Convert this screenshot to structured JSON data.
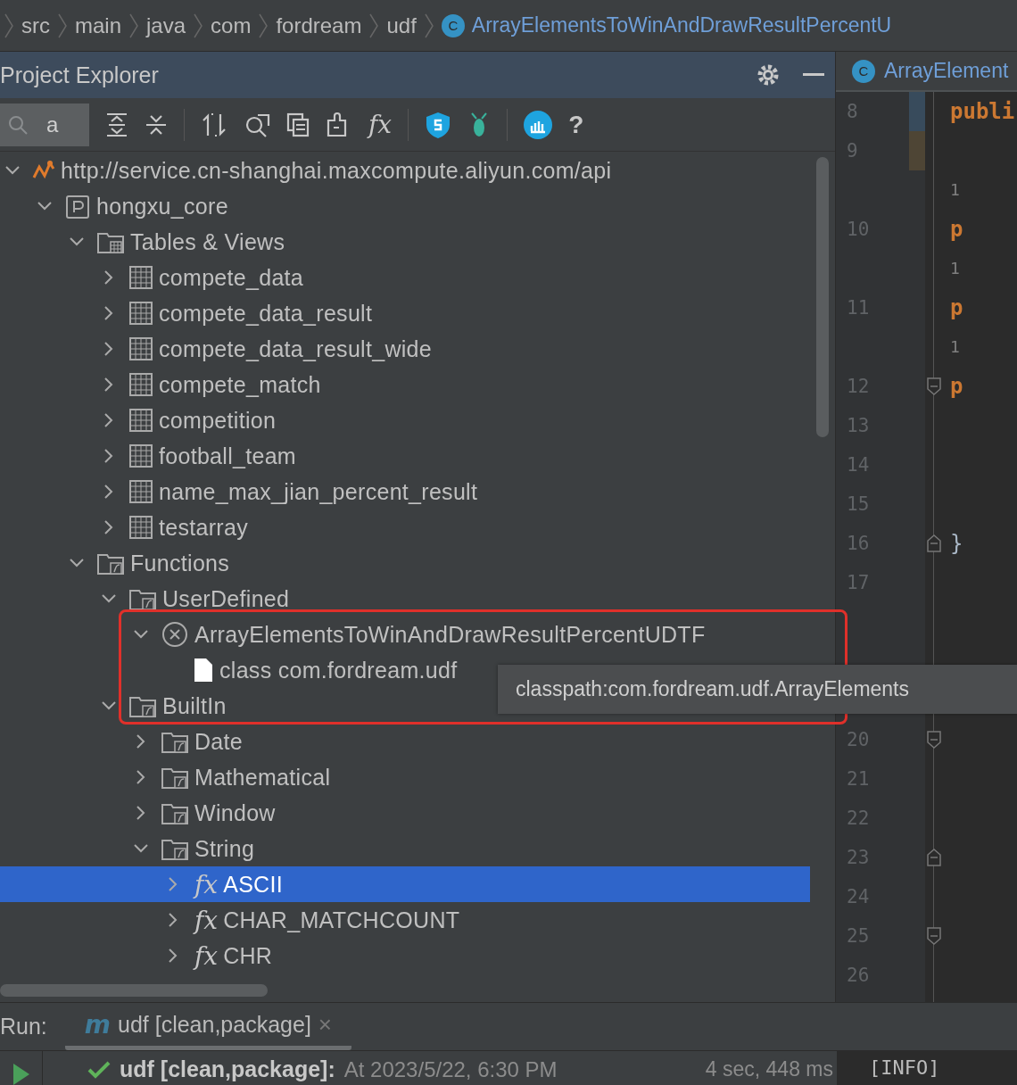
{
  "breadcrumb": {
    "items": [
      "src",
      "main",
      "java",
      "com",
      "fordream",
      "udf"
    ],
    "class_icon": "C",
    "current": "ArrayElementsToWinAndDrawResultPercentU"
  },
  "project_explorer": {
    "title": "Project Explorer",
    "search": {
      "value": "a"
    },
    "toolbar": [
      {
        "kind": "expand"
      },
      {
        "kind": "collapse"
      },
      {
        "kind": "sep"
      },
      {
        "kind": "sync"
      },
      {
        "kind": "find"
      },
      {
        "kind": "copy"
      },
      {
        "kind": "plugin"
      },
      {
        "kind": "function",
        "glyph": "fx"
      },
      {
        "kind": "sep"
      },
      {
        "kind": "shield"
      },
      {
        "kind": "bug"
      },
      {
        "kind": "sep"
      },
      {
        "kind": "chart"
      },
      {
        "kind": "help",
        "glyph": "?"
      }
    ],
    "tree": [
      {
        "label": "http://service.cn-shanghai.maxcompute.aliyun.com/api",
        "kind": "connection",
        "expanded": true,
        "selected": false,
        "children": [
          {
            "label": "hongxu_core",
            "kind": "project",
            "expanded": true,
            "selected": false,
            "children": [
              {
                "label": "Tables & Views",
                "kind": "tablefolder",
                "expanded": true,
                "selected": false,
                "children": [
                  {
                    "label": "compete_data",
                    "kind": "table",
                    "expanded": false,
                    "selected": false
                  },
                  {
                    "label": "compete_data_result",
                    "kind": "table",
                    "expanded": false,
                    "selected": false
                  },
                  {
                    "label": "compete_data_result_wide",
                    "kind": "table",
                    "expanded": false,
                    "selected": false
                  },
                  {
                    "label": "compete_match",
                    "kind": "table",
                    "expanded": false,
                    "selected": false
                  },
                  {
                    "label": "competition",
                    "kind": "table",
                    "expanded": false,
                    "selected": false
                  },
                  {
                    "label": "football_team",
                    "kind": "table",
                    "expanded": false,
                    "selected": false
                  },
                  {
                    "label": "name_max_jian_percent_result",
                    "kind": "table",
                    "expanded": false,
                    "selected": false
                  },
                  {
                    "label": "testarray",
                    "kind": "table",
                    "expanded": false,
                    "selected": false
                  }
                ]
              },
              {
                "label": "Functions",
                "kind": "fxfolder",
                "expanded": true,
                "selected": false,
                "children": [
                  {
                    "label": "UserDefined",
                    "kind": "fxfolder",
                    "expanded": true,
                    "selected": false,
                    "children": [
                      {
                        "label": "ArrayElementsToWinAndDrawResultPercentUDTF",
                        "kind": "error",
                        "expanded": true,
                        "selected": false,
                        "children": [
                          {
                            "label": "class com.fordream.udf",
                            "kind": "file",
                            "selected": false
                          }
                        ]
                      }
                    ]
                  },
                  {
                    "label": "BuiltIn",
                    "kind": "fxfolder",
                    "expanded": true,
                    "selected": false,
                    "children": [
                      {
                        "label": "Date",
                        "kind": "fxfolder",
                        "expanded": false,
                        "selected": false
                      },
                      {
                        "label": "Mathematical",
                        "kind": "fxfolder",
                        "expanded": false,
                        "selected": false
                      },
                      {
                        "label": "Window",
                        "kind": "fxfolder",
                        "expanded": false,
                        "selected": false
                      },
                      {
                        "label": "String",
                        "kind": "fxfolder",
                        "expanded": true,
                        "selected": false,
                        "children": [
                          {
                            "label": "ASCII",
                            "kind": "fx",
                            "glyph": "fx",
                            "expanded": false,
                            "selected": true
                          },
                          {
                            "label": "CHAR_MATCHCOUNT",
                            "kind": "fx",
                            "glyph": "fx",
                            "expanded": false,
                            "selected": false
                          },
                          {
                            "label": "CHR",
                            "kind": "fx",
                            "glyph": "fx",
                            "expanded": false,
                            "selected": false
                          }
                        ]
                      }
                    ]
                  }
                ]
              }
            ]
          }
        ]
      }
    ],
    "tooltip": "classpath:com.fordream.udf.ArrayElements"
  },
  "editor": {
    "tab": {
      "class_icon": "C",
      "title": "ArrayElement"
    },
    "rows": [
      {
        "kind": "line",
        "number": "8",
        "code": "publi",
        "color": "#384b5c"
      },
      {
        "kind": "line",
        "number": "9",
        "color": "#4e4535"
      },
      {
        "kind": "hint",
        "code": "1"
      },
      {
        "kind": "line",
        "number": "10",
        "code": "p"
      },
      {
        "kind": "hint",
        "code": "1"
      },
      {
        "kind": "line",
        "number": "11",
        "code": "p"
      },
      {
        "kind": "hint",
        "code": "1"
      },
      {
        "kind": "foldstart",
        "number": "12",
        "code": "p"
      },
      {
        "kind": "line",
        "number": "13"
      },
      {
        "kind": "line",
        "number": "14"
      },
      {
        "kind": "line",
        "number": "15"
      },
      {
        "kind": "foldend",
        "number": "16",
        "code": "}"
      },
      {
        "kind": "line",
        "number": "17"
      },
      {
        "kind": "blank"
      },
      {
        "kind": "blank"
      },
      {
        "kind": "blank"
      },
      {
        "kind": "foldstart",
        "number": "20"
      },
      {
        "kind": "line",
        "number": "21"
      },
      {
        "kind": "line",
        "number": "22"
      },
      {
        "kind": "foldend",
        "number": "23"
      },
      {
        "kind": "line",
        "number": "24"
      },
      {
        "kind": "foldstart",
        "number": "25"
      },
      {
        "kind": "line",
        "number": "26"
      }
    ]
  },
  "run": {
    "label": "Run:",
    "tab": {
      "glyph": "m",
      "title": "udf [clean,package]",
      "close": "×",
      "selected": true
    },
    "result": {
      "title": "udf [clean,package]:",
      "time": "At 2023/5/22, 6:30 PM",
      "duration": "4 sec, 448 ms",
      "success": true
    },
    "console": "[INFO]"
  }
}
